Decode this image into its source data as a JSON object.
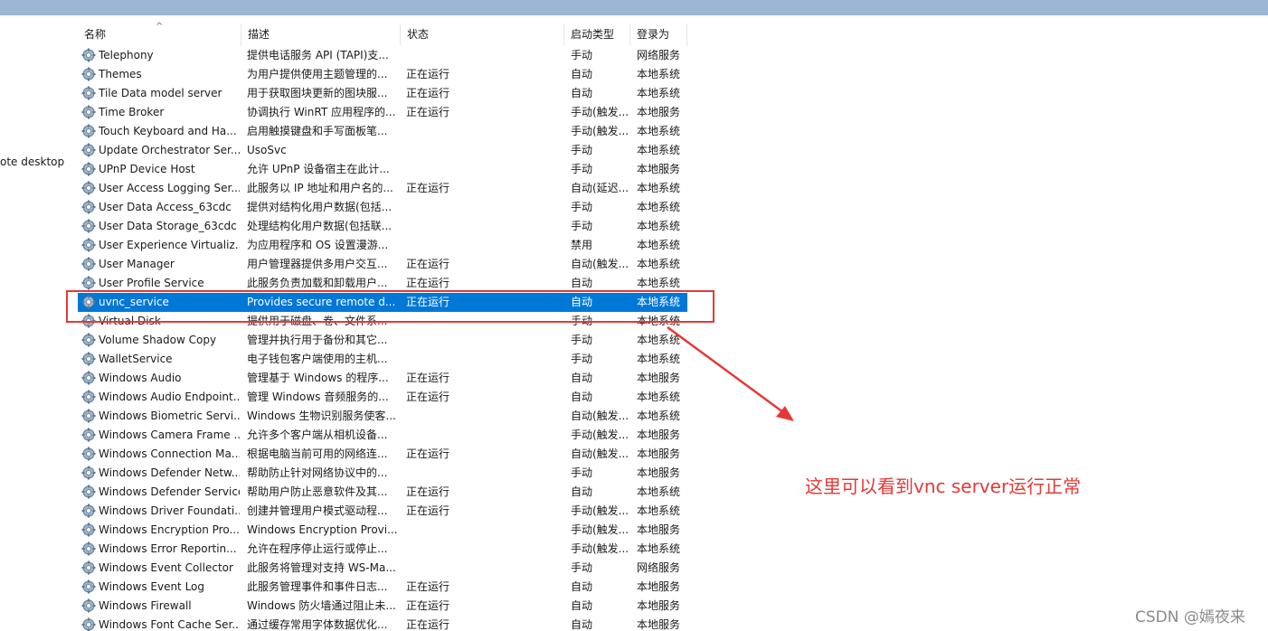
{
  "window": {
    "left_pane_text": "ote desktop"
  },
  "columns": [
    {
      "label": "名称"
    },
    {
      "label": "描述"
    },
    {
      "label": "状态"
    },
    {
      "label": "启动类型"
    },
    {
      "label": "登录为"
    }
  ],
  "sort_indicator": "^",
  "rows": [
    {
      "name": "Telephony",
      "desc": "提供电话服务 API (TAPI)支...",
      "status": "",
      "startup": "手动",
      "logon": "网络服务"
    },
    {
      "name": "Themes",
      "desc": "为用户提供使用主题管理的...",
      "status": "正在运行",
      "startup": "自动",
      "logon": "本地系统"
    },
    {
      "name": "Tile Data model server",
      "desc": "用于获取图块更新的图块服...",
      "status": "正在运行",
      "startup": "自动",
      "logon": "本地系统"
    },
    {
      "name": "Time Broker",
      "desc": "协调执行 WinRT 应用程序的...",
      "status": "正在运行",
      "startup": "手动(触发...",
      "logon": "本地服务"
    },
    {
      "name": "Touch Keyboard and Ha...",
      "desc": "启用触摸键盘和手写面板笔...",
      "status": "",
      "startup": "手动(触发...",
      "logon": "本地系统"
    },
    {
      "name": "Update Orchestrator Ser...",
      "desc": "UsoSvc",
      "status": "",
      "startup": "手动",
      "logon": "本地系统"
    },
    {
      "name": "UPnP Device Host",
      "desc": "允许 UPnP 设备宿主在此计...",
      "status": "",
      "startup": "手动",
      "logon": "本地服务"
    },
    {
      "name": "User Access Logging Ser...",
      "desc": "此服务以 IP 地址和用户名的...",
      "status": "正在运行",
      "startup": "自动(延迟...",
      "logon": "本地系统"
    },
    {
      "name": "User Data Access_63cdc",
      "desc": "提供对结构化用户数据(包括...",
      "status": "",
      "startup": "手动",
      "logon": "本地系统"
    },
    {
      "name": "User Data Storage_63cdc",
      "desc": "处理结构化用户数据(包括联...",
      "status": "",
      "startup": "手动",
      "logon": "本地系统"
    },
    {
      "name": "User Experience Virtualiz...",
      "desc": "为应用程序和 OS 设置漫游...",
      "status": "",
      "startup": "禁用",
      "logon": "本地系统"
    },
    {
      "name": "User Manager",
      "desc": "用户管理器提供多用户交互...",
      "status": "正在运行",
      "startup": "自动(触发...",
      "logon": "本地系统"
    },
    {
      "name": "User Profile Service",
      "desc": "此服务负责加载和卸载用户...",
      "status": "正在运行",
      "startup": "自动",
      "logon": "本地系统"
    },
    {
      "name": "uvnc_service",
      "desc": "Provides secure remote d...",
      "status": "正在运行",
      "startup": "自动",
      "logon": "本地系统",
      "selected": true
    },
    {
      "name": "Virtual Disk",
      "desc": "提供用于磁盘、卷、文件系...",
      "status": "",
      "startup": "手动",
      "logon": "本地系统"
    },
    {
      "name": "Volume Shadow Copy",
      "desc": "管理并执行用于备份和其它...",
      "status": "",
      "startup": "手动",
      "logon": "本地系统"
    },
    {
      "name": "WalletService",
      "desc": "电子钱包客户端使用的主机...",
      "status": "",
      "startup": "手动",
      "logon": "本地系统"
    },
    {
      "name": "Windows Audio",
      "desc": "管理基于 Windows 的程序...",
      "status": "正在运行",
      "startup": "自动",
      "logon": "本地服务"
    },
    {
      "name": "Windows Audio Endpoint...",
      "desc": "管理 Windows 音频服务的...",
      "status": "正在运行",
      "startup": "自动",
      "logon": "本地系统"
    },
    {
      "name": "Windows Biometric Servi...",
      "desc": "Windows 生物识别服务使客...",
      "status": "",
      "startup": "自动(触发...",
      "logon": "本地系统"
    },
    {
      "name": "Windows Camera Frame ...",
      "desc": "允许多个客户端从相机设备...",
      "status": "",
      "startup": "手动(触发...",
      "logon": "本地服务"
    },
    {
      "name": "Windows Connection Ma...",
      "desc": "根据电脑当前可用的网络连...",
      "status": "正在运行",
      "startup": "自动(触发...",
      "logon": "本地服务"
    },
    {
      "name": "Windows Defender Netw...",
      "desc": "帮助防止针对网络协议中的...",
      "status": "",
      "startup": "手动",
      "logon": "本地服务"
    },
    {
      "name": "Windows Defender Service",
      "desc": "帮助用户防止恶意软件及其...",
      "status": "正在运行",
      "startup": "自动",
      "logon": "本地系统"
    },
    {
      "name": "Windows Driver Foundati...",
      "desc": "创建并管理用户模式驱动程...",
      "status": "正在运行",
      "startup": "手动(触发...",
      "logon": "本地系统"
    },
    {
      "name": "Windows Encryption Pro...",
      "desc": "Windows Encryption Provi...",
      "status": "",
      "startup": "手动(触发...",
      "logon": "本地服务"
    },
    {
      "name": "Windows Error Reportin...",
      "desc": "允许在程序停止运行或停止...",
      "status": "",
      "startup": "手动(触发...",
      "logon": "本地系统"
    },
    {
      "name": "Windows Event Collector",
      "desc": "此服务将管理对支持 WS-Ma...",
      "status": "",
      "startup": "手动",
      "logon": "网络服务"
    },
    {
      "name": "Windows Event Log",
      "desc": "此服务管理事件和事件日志...",
      "status": "正在运行",
      "startup": "自动",
      "logon": "本地服务"
    },
    {
      "name": "Windows Firewall",
      "desc": "Windows 防火墙通过阻止未...",
      "status": "正在运行",
      "startup": "自动",
      "logon": "本地服务"
    },
    {
      "name": "Windows Font Cache Ser...",
      "desc": "通过缓存常用字体数据优化...",
      "status": "正在运行",
      "startup": "自动",
      "logon": "本地服务"
    }
  ],
  "annotation": {
    "text": "这里可以看到vnc server运行正常",
    "color": "#e53935"
  },
  "watermark": "CSDN @嫣夜来",
  "colors": {
    "selection": "#0078d7",
    "title_strip": "#9cb5d4"
  },
  "icons": {
    "service": "gear-icon"
  }
}
